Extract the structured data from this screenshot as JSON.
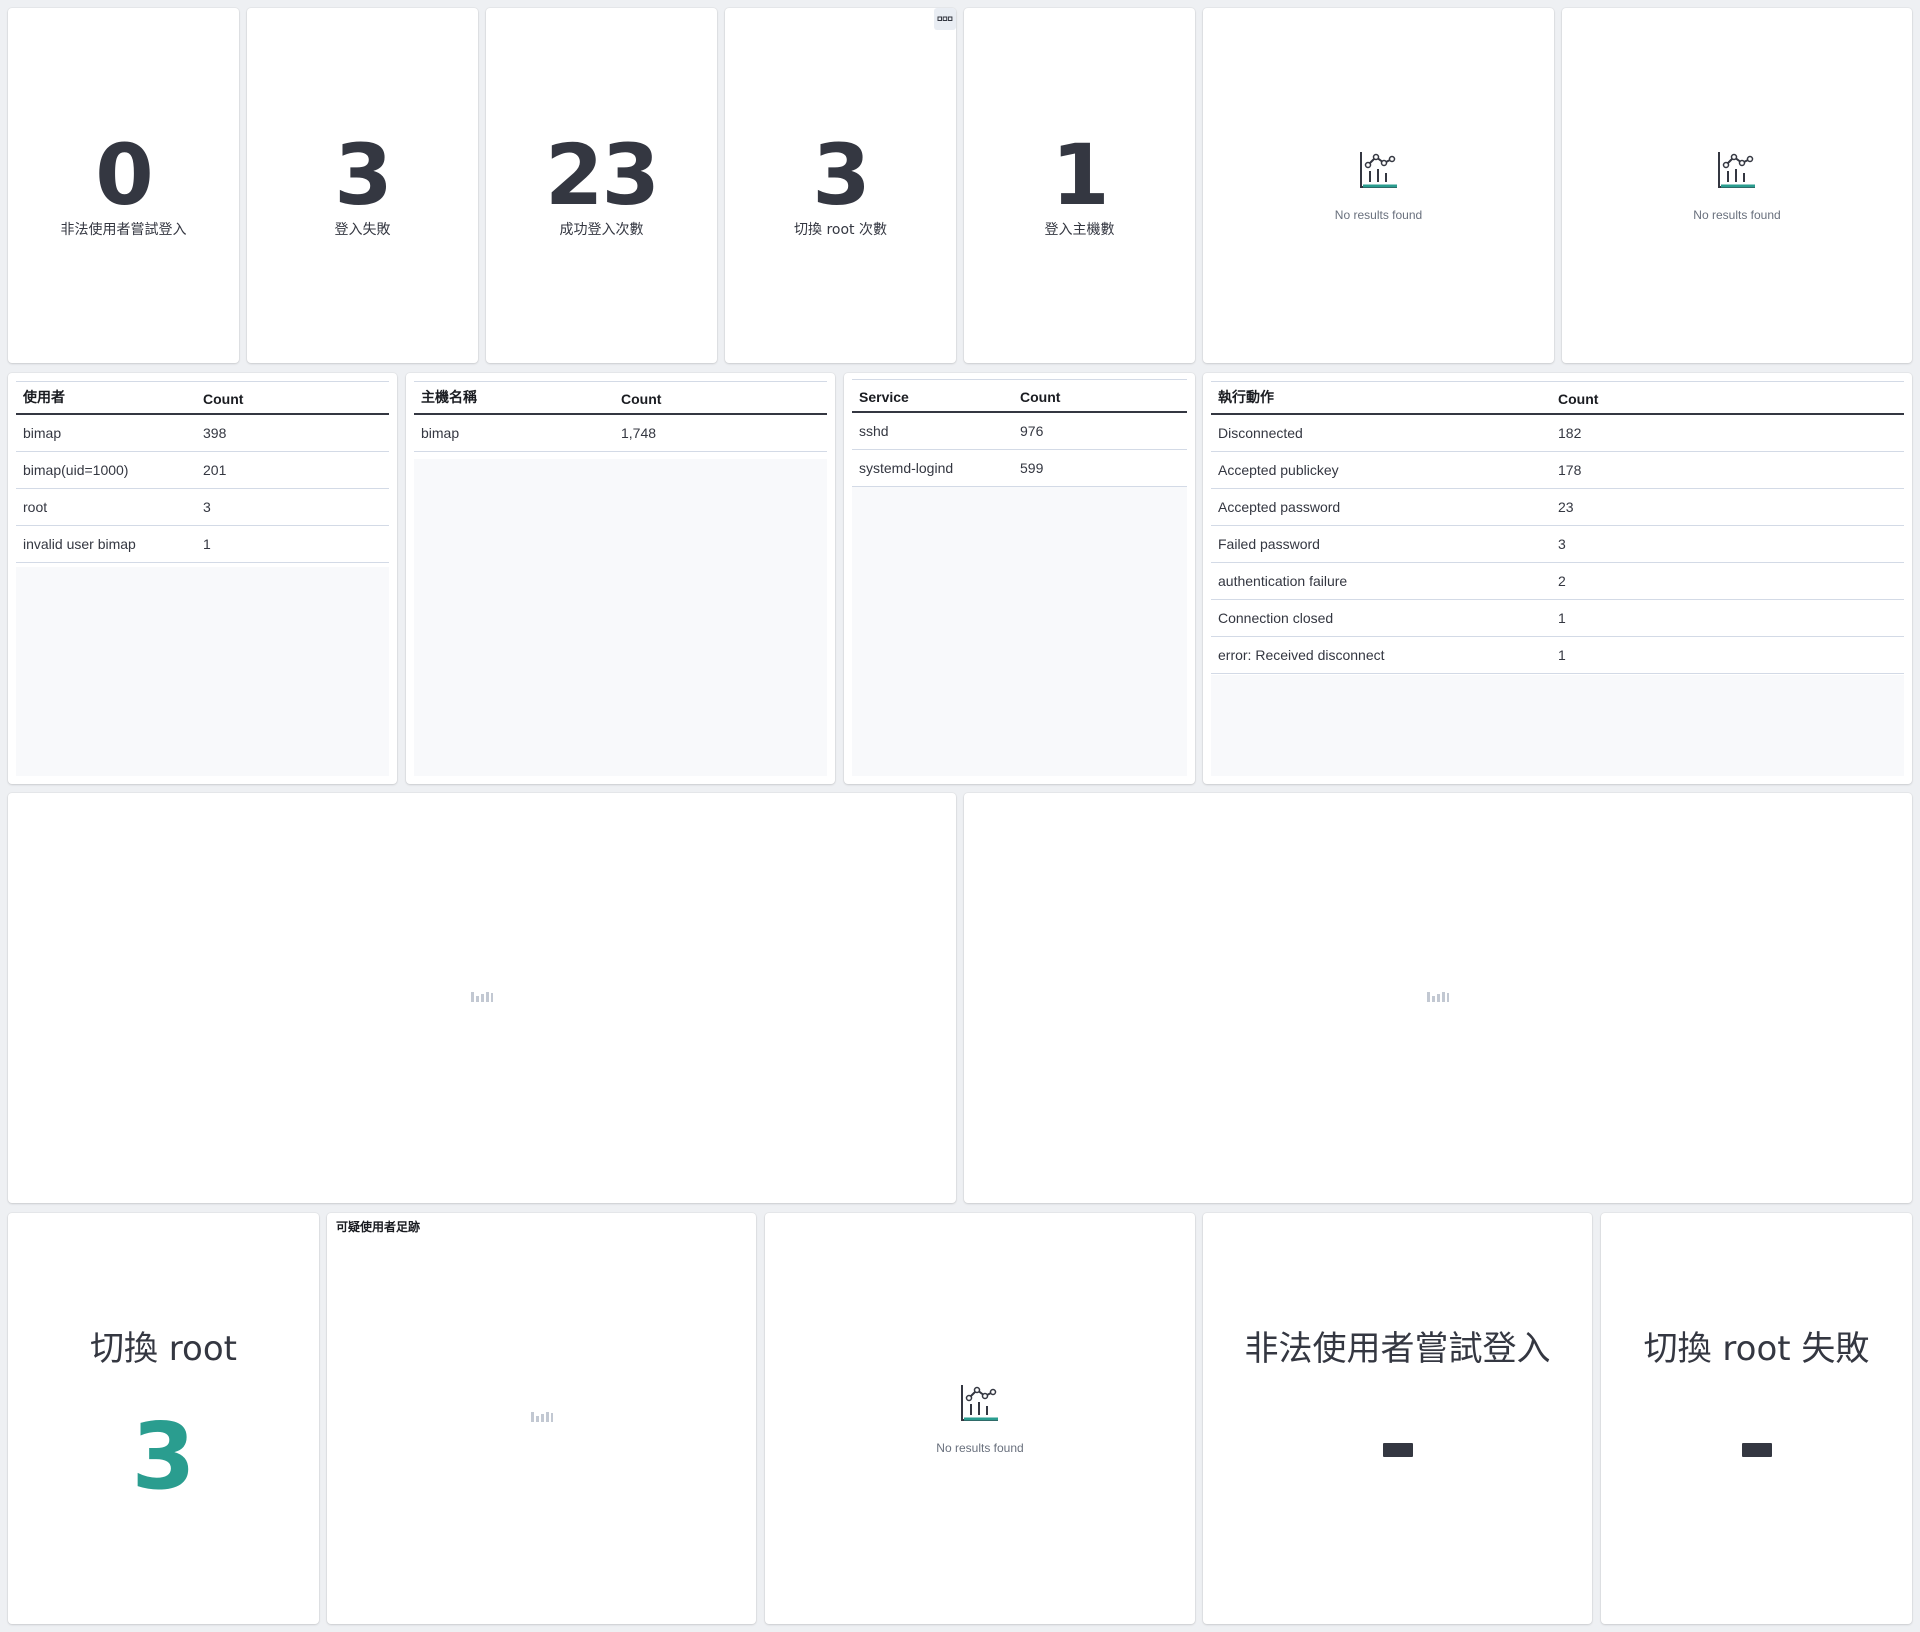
{
  "metrics": [
    {
      "value": "0",
      "label": "非法使用者嘗試登入"
    },
    {
      "value": "3",
      "label": "登入失敗"
    },
    {
      "value": "23",
      "label": "成功登入次數"
    },
    {
      "value": "3",
      "label": "切換 root 次數"
    },
    {
      "value": "1",
      "label": "登入主機數"
    }
  ],
  "no_results_text": "No results found",
  "tables": {
    "users": {
      "headers": [
        "使用者",
        "Count"
      ],
      "rows": [
        [
          "bimap",
          "398"
        ],
        [
          "bimap(uid=1000)",
          "201"
        ],
        [
          "root",
          "3"
        ],
        [
          "invalid user bimap",
          "1"
        ]
      ]
    },
    "hosts": {
      "headers": [
        "主機名稱",
        "Count"
      ],
      "rows": [
        [
          "bimap",
          "1,748"
        ]
      ]
    },
    "services": {
      "headers": [
        "Service",
        "Count"
      ],
      "rows": [
        [
          "sshd",
          "976"
        ],
        [
          "systemd-logind",
          "599"
        ]
      ]
    },
    "actions": {
      "headers": [
        "執行動作",
        "Count"
      ],
      "rows": [
        [
          "Disconnected",
          "182"
        ],
        [
          "Accepted publickey",
          "178"
        ],
        [
          "Accepted password",
          "23"
        ],
        [
          "Failed password",
          "3"
        ],
        [
          "authentication failure",
          "2"
        ],
        [
          "Connection closed",
          "1"
        ],
        [
          "error: Received disconnect",
          "1"
        ]
      ]
    }
  },
  "bottom": {
    "switch_root": {
      "title": "切換 root",
      "value": "3",
      "value_color": "#2a9d8f"
    },
    "suspicious_title": "可疑使用者足跡",
    "illegal_login_title": "非法使用者嘗試登入",
    "switch_root_fail_title": "切換 root 失敗"
  },
  "icons": {
    "panel_menu": "ellipsis-icon",
    "empty_chart": "visualize-app-icon",
    "loading": "loading-chart-icon"
  }
}
